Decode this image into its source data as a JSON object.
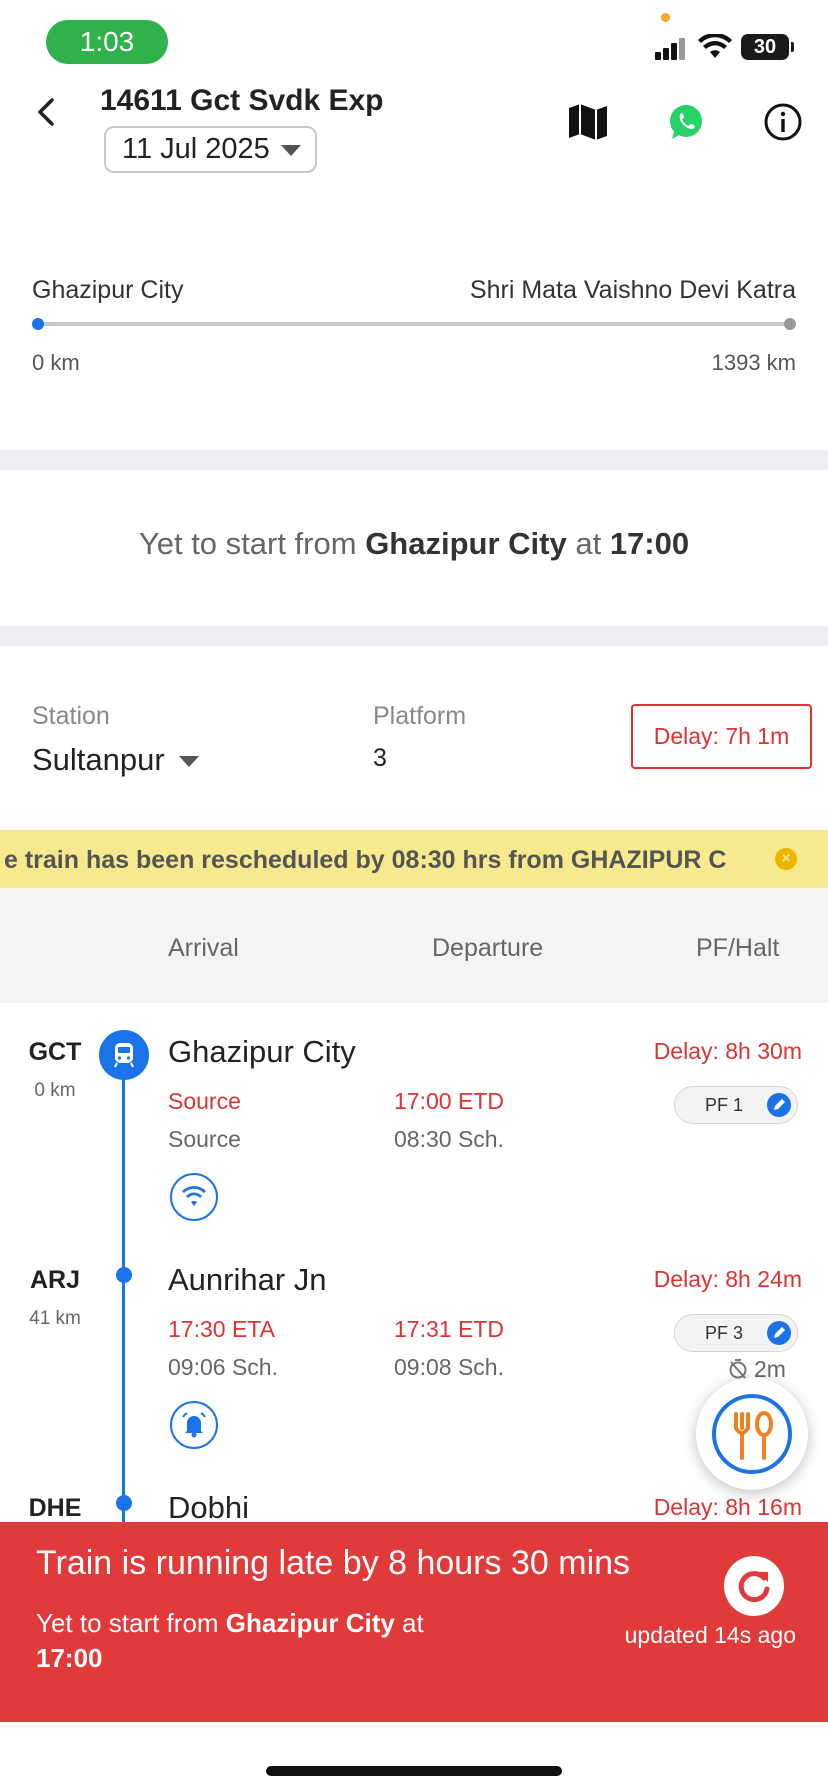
{
  "status_bar": {
    "time": "1:03",
    "battery": "30"
  },
  "header": {
    "train_title": "14611 Gct Svdk Exp",
    "date": "11 Jul 2025",
    "icons": [
      "back-arrow-icon",
      "map-icon",
      "whatsapp-icon",
      "info-icon"
    ]
  },
  "route": {
    "from": "Ghazipur City",
    "to": "Shri Mata Vaishno Devi Katra",
    "start_km": "0 km",
    "end_km": "1393 km",
    "progress_fraction": 0
  },
  "start_message": {
    "prefix": "Yet to start from",
    "station": "Ghazipur City",
    "mid": "at",
    "time": "17:00"
  },
  "station_info": {
    "station_label": "Station",
    "station_value": "Sultanpur",
    "platform_label": "Platform",
    "platform_value": "3",
    "delay": "Delay: 7h 1m"
  },
  "banner": {
    "text": "e train has been rescheduled by 08:30 hrs from GHAZIPUR C"
  },
  "table_header": {
    "arrival": "Arrival",
    "departure": "Departure",
    "pf_halt": "PF/Halt"
  },
  "stations": [
    {
      "code": "GCT",
      "km": "0 km",
      "name": "Ghazipur City",
      "delay": "Delay: 8h 30m",
      "arr_actual": "Source",
      "arr_sched": "Source",
      "dep_actual": "17:00 ETD",
      "dep_sched": "08:30 Sch.",
      "pf": "PF 1",
      "icon": "wifi-icon"
    },
    {
      "code": "ARJ",
      "km": "41 km",
      "name": "Aunrihar Jn",
      "delay": "Delay: 8h 24m",
      "arr_actual": "17:30 ETA",
      "arr_sched": "09:06 Sch.",
      "dep_actual": "17:31 ETD",
      "dep_sched": "09:08 Sch.",
      "pf": "PF 3",
      "halt": "2m",
      "icon": "alarm-bell-icon"
    },
    {
      "code": "DHE",
      "name": "Dobhi",
      "delay": "Delay: 8h 16m"
    }
  ],
  "bottom_panel": {
    "title": "Train is running late by 8 hours 30 mins",
    "sub_prefix": "Yet to start from",
    "sub_station": "Ghazipur City",
    "sub_mid": "at",
    "sub_time": "17:00",
    "updated": "updated 14s ago"
  },
  "colors": {
    "accent_blue": "#1a73e8",
    "delay_red": "#d33333",
    "banner_yellow": "#f7e98e",
    "panel_red": "#e03a3a",
    "status_green": "#2fb24c"
  }
}
